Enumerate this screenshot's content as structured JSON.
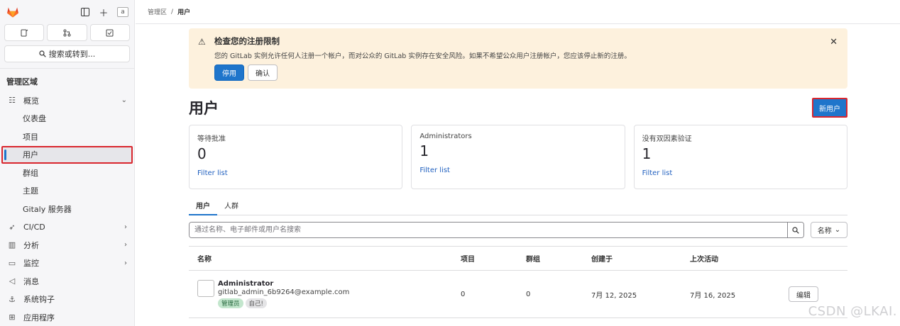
{
  "sidebar": {
    "avatar_text": "a",
    "search_label": "搜索或转到...",
    "section_title": "管理区域",
    "items": [
      {
        "label": "概览",
        "icon": "overview-icon",
        "chevron": "⌄"
      },
      {
        "label": "仪表盘"
      },
      {
        "label": "项目"
      },
      {
        "label": "用户"
      },
      {
        "label": "群组"
      },
      {
        "label": "主题"
      },
      {
        "label": "Gitaly 服务器"
      },
      {
        "label": "CI/CD",
        "icon": "rocket-icon",
        "chevron": "›"
      },
      {
        "label": "分析",
        "icon": "chart-icon",
        "chevron": "›"
      },
      {
        "label": "监控",
        "icon": "monitor-icon",
        "chevron": "›"
      },
      {
        "label": "消息",
        "icon": "megaphone-icon"
      },
      {
        "label": "系统钩子",
        "icon": "anchor-icon"
      },
      {
        "label": "应用程序",
        "icon": "apps-icon"
      }
    ]
  },
  "breadcrumb": {
    "parent": "管理区",
    "separator": "/",
    "current": "用户"
  },
  "alert": {
    "title": "检查您的注册限制",
    "text": "您的 GitLab 实例允许任何人注册一个帐户，而对公众的 GitLab 实例存在安全风险。如果不希望公众用户注册帐户，您应该停止新的注册。",
    "primary_button": "停用",
    "secondary_button": "确认"
  },
  "page": {
    "title": "用户",
    "new_user_button": "新用户"
  },
  "stats": [
    {
      "label": "等待批准",
      "value": "0",
      "link": "Filter list"
    },
    {
      "label": "Administrators",
      "value": "1",
      "link": "Filter list"
    },
    {
      "label": "没有双因素验证",
      "value": "1",
      "link": "Filter list"
    }
  ],
  "tabs": [
    {
      "label": "用户"
    },
    {
      "label": "人群"
    }
  ],
  "filter": {
    "placeholder": "通过名称、电子邮件或用户名搜索",
    "sort_label": "名称"
  },
  "table": {
    "headers": [
      "名称",
      "项目",
      "群组",
      "创建于",
      "上次活动"
    ],
    "rows": [
      {
        "name": "Administrator",
        "email": "gitlab_admin_6b9264@example.com",
        "badge_admin": "管理员",
        "badge_self": "自己!",
        "projects": "0",
        "groups": "0",
        "created": "7月 12, 2025",
        "last_activity": "7月 16, 2025",
        "edit_label": "编辑"
      }
    ]
  },
  "watermark": "CSDN @LKAI.",
  "colors": {
    "primary": "#1f75cb",
    "highlight_border": "#d9262e",
    "alert_bg": "#fdf1dd"
  }
}
